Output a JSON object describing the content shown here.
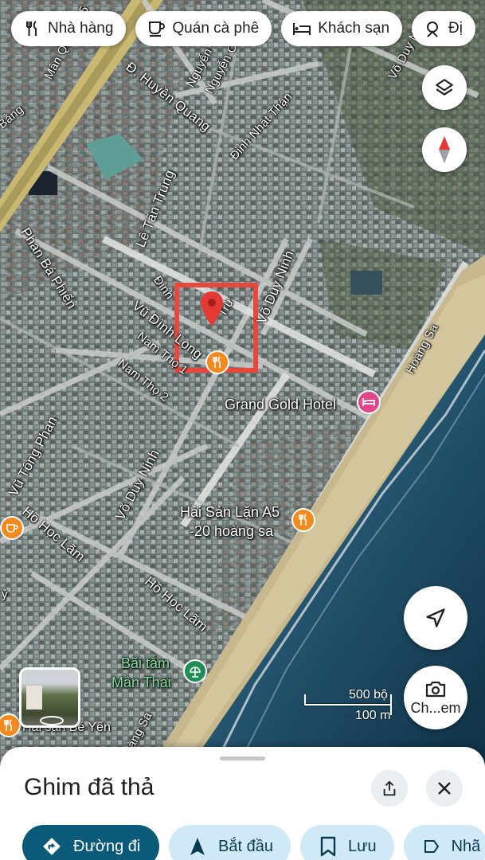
{
  "chips": [
    {
      "label": "Nhà hàng",
      "icon": "restaurant-icon"
    },
    {
      "label": "Quán cà phê",
      "icon": "coffee-icon"
    },
    {
      "label": "Khách sạn",
      "icon": "hotel-icon"
    },
    {
      "label": "Đị",
      "icon": "attraction-icon"
    }
  ],
  "streets": {
    "man_quang": "Mân Quang 15",
    "huyen_quang": "Đ. Huyền Quang",
    "nguyen_a": "Nguyễn",
    "nguyen_b": "Nguyễn C",
    "dinh_nhat_than": "Đinh Nhật Thận",
    "vo_duy_ninh_top": "Võ Duy N",
    "le_tan_trung": "Lê Tấn Trung",
    "phan_ba_phien": "Phan Bá Phiến",
    "bang": "Bằng",
    "dinh_tu": "Đinh",
    "tru": "Trừ",
    "vo_duy_ninh_mid": "Võ Duy Ninh",
    "vu_dinh_long": "Vũ Đình Long",
    "nam_tho_1": "Nam Thọ 1",
    "nam_tho_2": "Nam Thọ 2",
    "hoang_sa_top": "Hoàng Sa",
    "vu_tong_phan": "Vũ Tông Phan",
    "vo_duy_ninh_low": "Võ Duy Ninh",
    "ho_hoc_lam_a": "Hồ Học Lãm",
    "ho_hoc_lam_b": "Hồ Học Lãm",
    "hoang_sa_bottom": "àng Sa",
    "cy": "ỷ"
  },
  "pois": {
    "grand_gold": "Grand Gold Hotel",
    "hai_san_line1": "Hải Sản Lặn A5",
    "hai_san_line2": "-20 hoàng sa",
    "bai_tam_line1": "Bãi tắm",
    "bai_tam_line2": "Mân Thái",
    "hai_san_be_yen": "Hải sản Bé Yến"
  },
  "scale": {
    "top": "500 bộ",
    "bottom": "100 m"
  },
  "controls": {
    "layers": "layers-icon",
    "compass": "compass-icon",
    "my_location": "navigation-arrow-icon",
    "camera_label": "Ch...em"
  },
  "sheet": {
    "title": "Ghim đã thả",
    "actions": [
      {
        "label": "Đường đi",
        "icon": "directions-icon"
      },
      {
        "label": "Bắt đầu",
        "icon": "navigation-icon"
      },
      {
        "label": "Lưu",
        "icon": "bookmark-icon"
      },
      {
        "label": "Nhã",
        "icon": "label-icon"
      }
    ]
  },
  "colors": {
    "accent": "#0b5a7a",
    "tonal": "#cfe9f6",
    "pin": "#e53935",
    "selection_box": "#e8473d",
    "poi_orange": "#f28a1e",
    "poi_pink": "#e2468a",
    "poi_green": "#1f8d55"
  }
}
